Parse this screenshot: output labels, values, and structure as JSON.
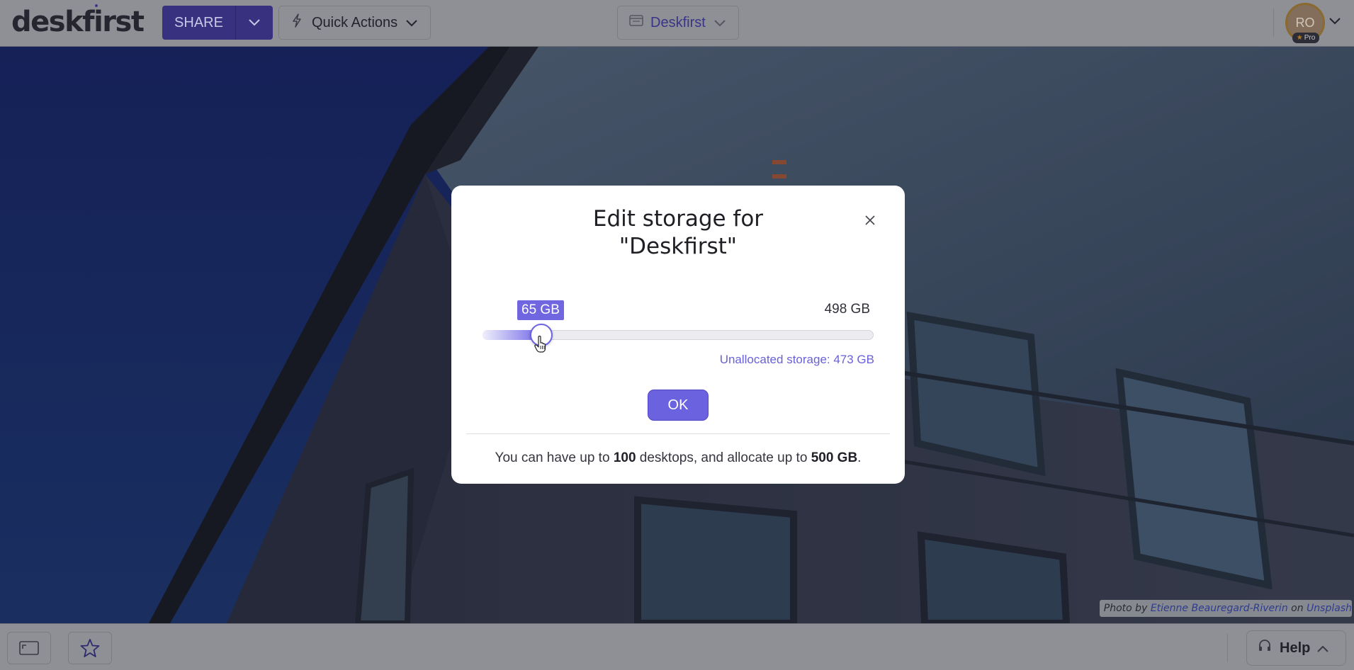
{
  "header": {
    "logo_text": "deskfirst",
    "share_label": "SHARE",
    "quick_actions_label": "Quick Actions",
    "desktop_selector_label": "Deskfirst",
    "avatar_initials": "RO",
    "pro_badge": "Pro"
  },
  "modal": {
    "title_line1": "Edit storage for",
    "title_line2": "\"Deskfirst\"",
    "slider": {
      "current_value_label": "65 GB",
      "max_label": "498 GB",
      "current_value_gb": 65,
      "max_value_gb": 498
    },
    "unallocated_label": "Unallocated storage: 473 GB",
    "ok_label": "OK",
    "footer": {
      "prefix": "You can have up to",
      "desktops_count": "100",
      "middle": "desktops, and allocate up to",
      "storage_limit": "500 GB",
      "suffix": "."
    }
  },
  "photo_credit": {
    "prefix": "Photo by",
    "author": "Etienne Beauregard-Riverin",
    "middle": "on",
    "source": "Unsplash"
  },
  "bottom_bar": {
    "help_label": "Help"
  },
  "colors": {
    "accent": "#6b62e0",
    "share_button_dimmed": "#37317f",
    "bar_dimmed": "#8e9096"
  },
  "icons": [
    "bolt-icon",
    "desktop-icon",
    "chevron-down-icon",
    "close-icon",
    "fullscreen-icon",
    "star-icon",
    "headset-icon",
    "chevron-up-icon",
    "hand-cursor-icon"
  ]
}
